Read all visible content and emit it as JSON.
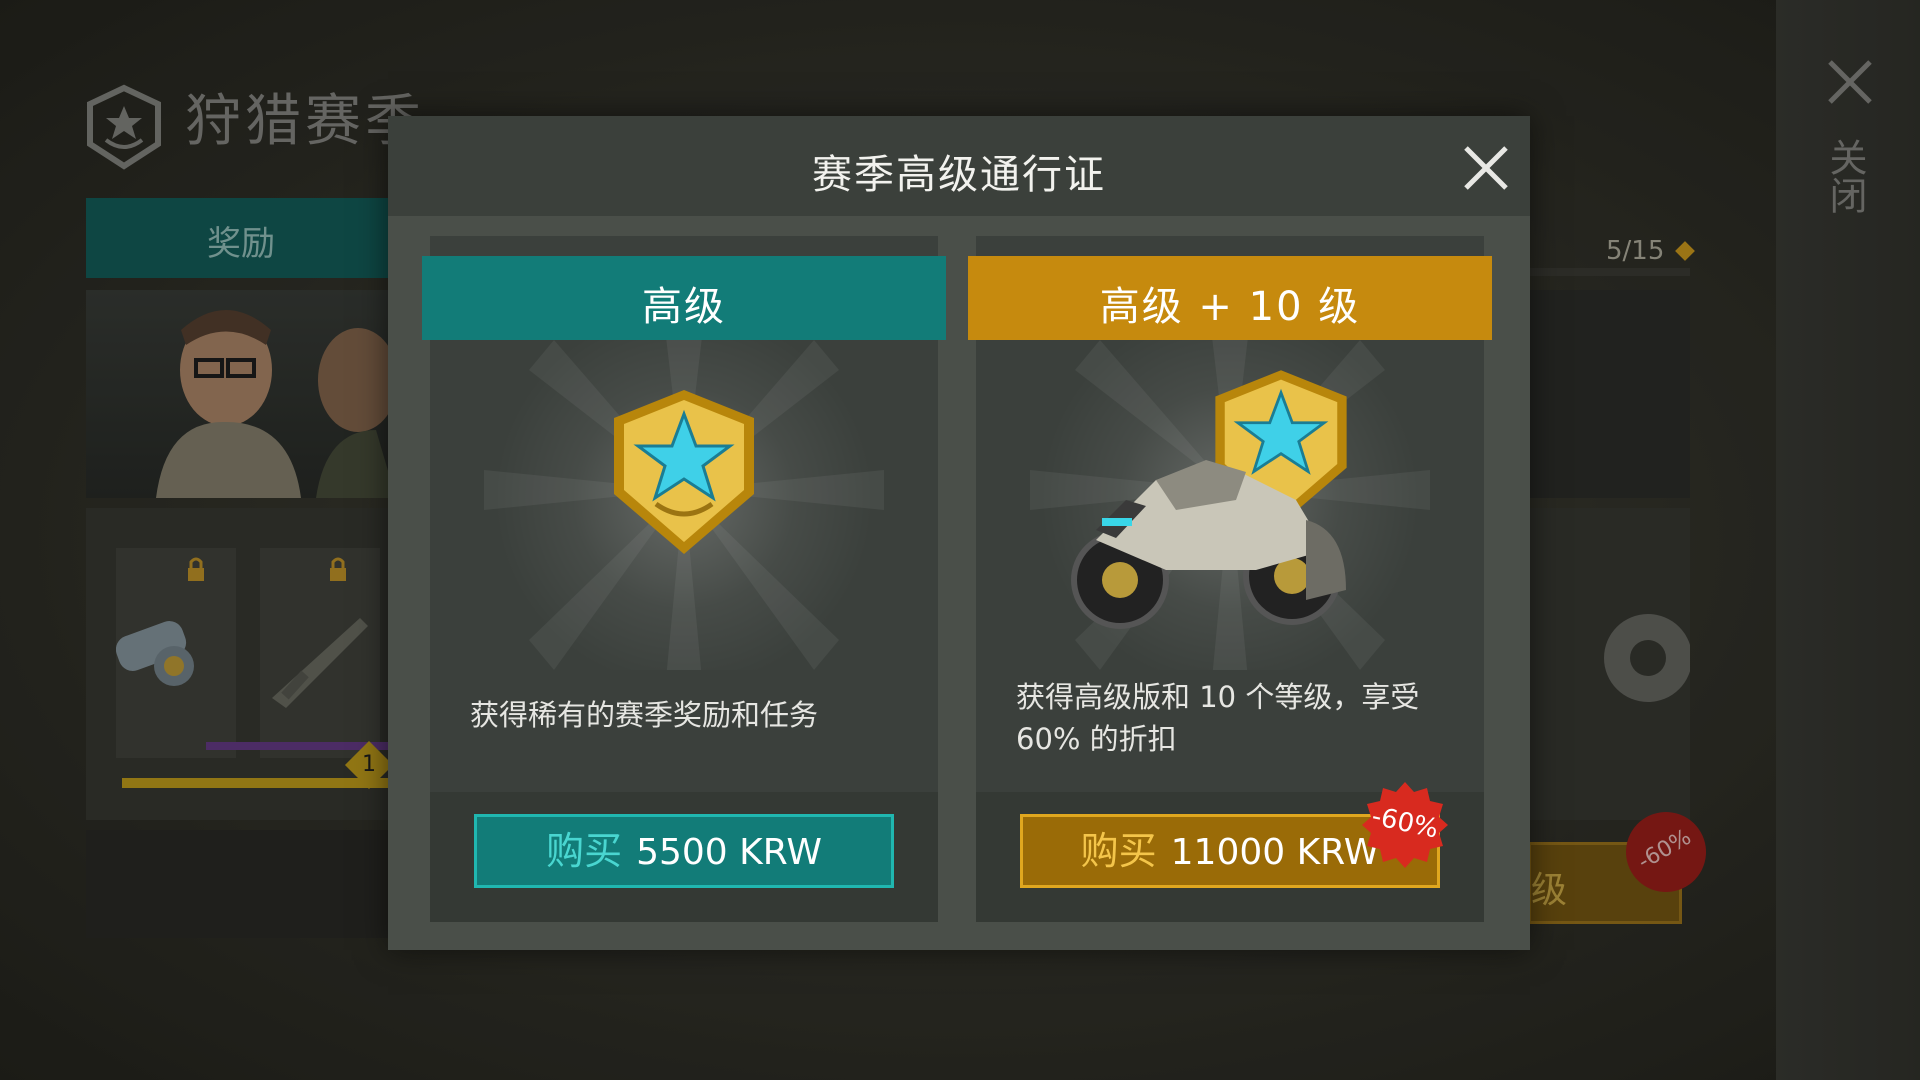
{
  "background": {
    "season_title": "狩猎赛季",
    "tab_label": "奖励",
    "progress_count": "5/15",
    "reward_level_badge": "1",
    "right_button_partial": "级",
    "right_discount": "-60%",
    "side_close_label": "关闭"
  },
  "modal": {
    "title": "赛季高级通行证",
    "cards": [
      {
        "tier": "高级",
        "description": "获得稀有的赛季奖励和任务",
        "buy_word": "购买",
        "price": "5500 KRW"
      },
      {
        "tier": "高级 + 10 级",
        "description": "获得高级版和 10 个等级，享受 60% 的折扣",
        "buy_word": "购买",
        "price": "11000 KRW",
        "discount": "-60%"
      }
    ]
  },
  "icons": [
    "season-emblem-icon",
    "close-icon",
    "premium-badge-icon",
    "motorcycle-icon",
    "lock-icon",
    "binoculars-icon",
    "rifle-icon",
    "gear-icon"
  ],
  "colors": {
    "teal": "#127c78",
    "gold": "#c68a0e",
    "discount_red": "#d82a1f",
    "modal_bg": "#4a4f49"
  }
}
